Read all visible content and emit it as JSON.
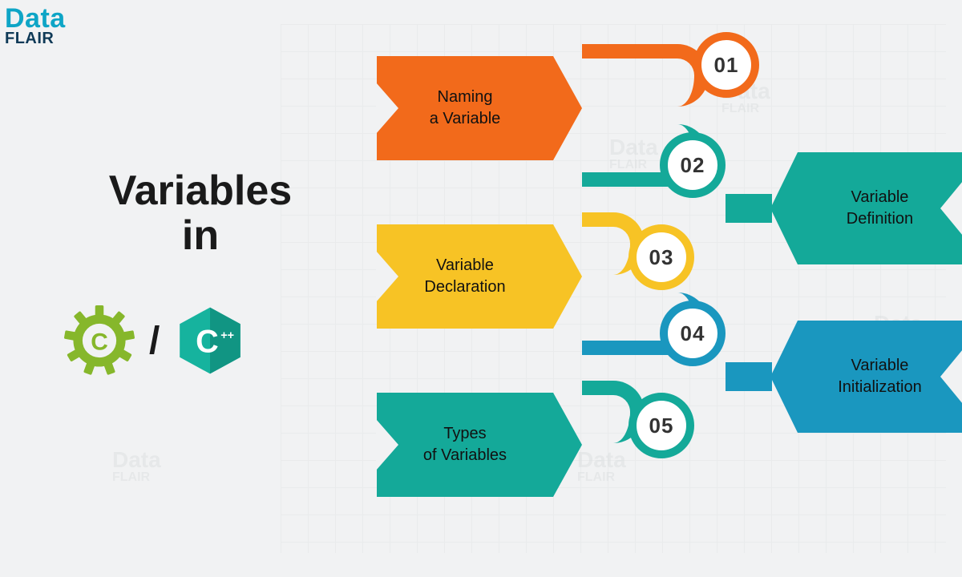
{
  "brand": {
    "line1": "Data",
    "line2": "FLAIR"
  },
  "title": {
    "line1": "Variables",
    "line2": "in"
  },
  "lang": {
    "c": "C",
    "cpp": "C",
    "cpp_sup": "++"
  },
  "steps": [
    {
      "num": "01",
      "label_l1": "Naming",
      "label_l2": "a Variable",
      "color": "#f26a1b"
    },
    {
      "num": "02",
      "label_l1": "Variable",
      "label_l2": "Definition",
      "color": "#14a999"
    },
    {
      "num": "03",
      "label_l1": "Variable",
      "label_l2": "Declaration",
      "color": "#f7c325"
    },
    {
      "num": "04",
      "label_l1": "Variable",
      "label_l2": "Initialization",
      "color": "#1a97bf"
    },
    {
      "num": "05",
      "label_l1": "Types",
      "label_l2": "of Variables",
      "color": "#14a999"
    }
  ]
}
